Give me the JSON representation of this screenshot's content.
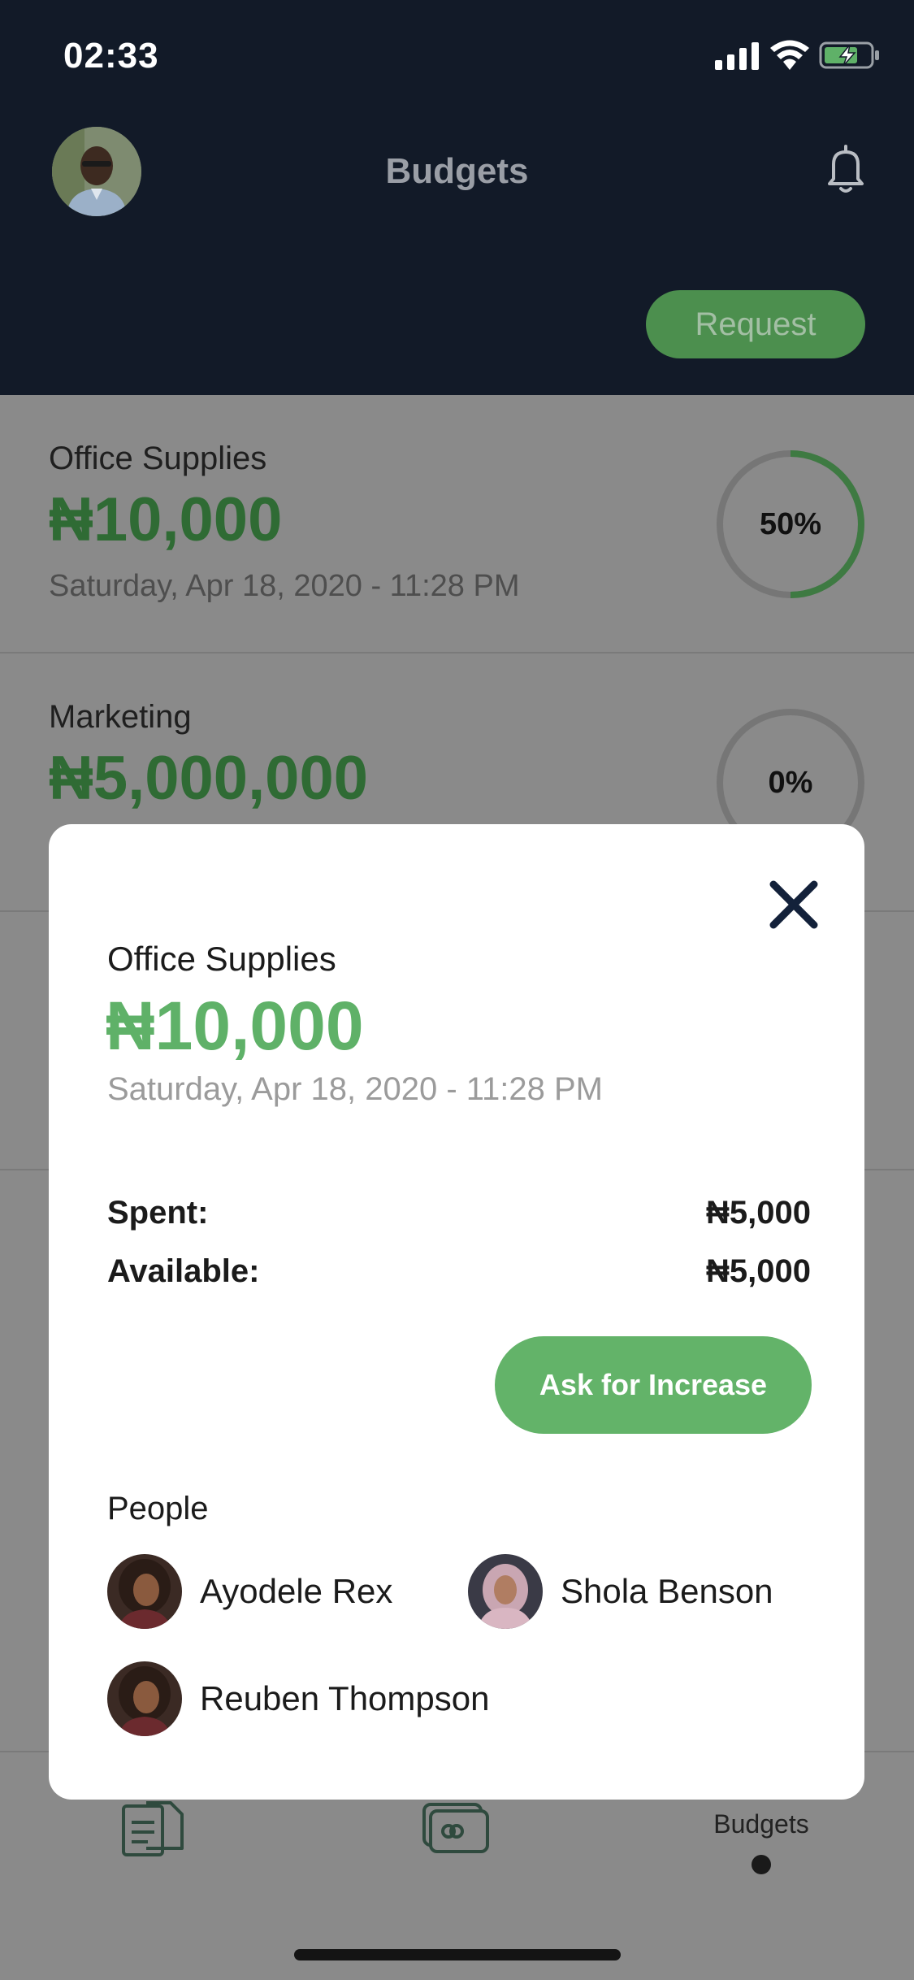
{
  "status_bar": {
    "time": "02:33"
  },
  "header": {
    "title": "Budgets",
    "request_label": "Request"
  },
  "budgets": [
    {
      "name": "Office Supplies",
      "amount": "₦10,000",
      "date": "Saturday, Apr 18, 2020 - 11:28 PM",
      "progress_label": "50%",
      "progress": 0.5
    },
    {
      "name": "Marketing",
      "amount": "₦5,000,000",
      "date": "",
      "progress_label": "0%",
      "progress": 0
    }
  ],
  "modal": {
    "name": "Office Supplies",
    "amount": "₦10,000",
    "date": "Saturday, Apr 18, 2020 - 11:28 PM",
    "spent_label": "Spent:",
    "spent_value": "₦5,000",
    "available_label": "Available:",
    "available_value": "₦5,000",
    "ask_button": "Ask for Increase",
    "people_title": "People",
    "people": [
      {
        "name": "Ayodele Rex"
      },
      {
        "name": "Shola Benson"
      },
      {
        "name": "Reuben Thompson"
      }
    ]
  },
  "bottom_nav": {
    "budgets_label": "Budgets"
  },
  "colors": {
    "header_bg": "#121a28",
    "accent_green": "#5fb168",
    "overlay_bg": "#8a8a8a"
  },
  "icons": [
    "signal-icon",
    "wifi-icon",
    "battery-icon",
    "bell-icon",
    "close-icon",
    "documents-icon",
    "wallet-icon"
  ]
}
